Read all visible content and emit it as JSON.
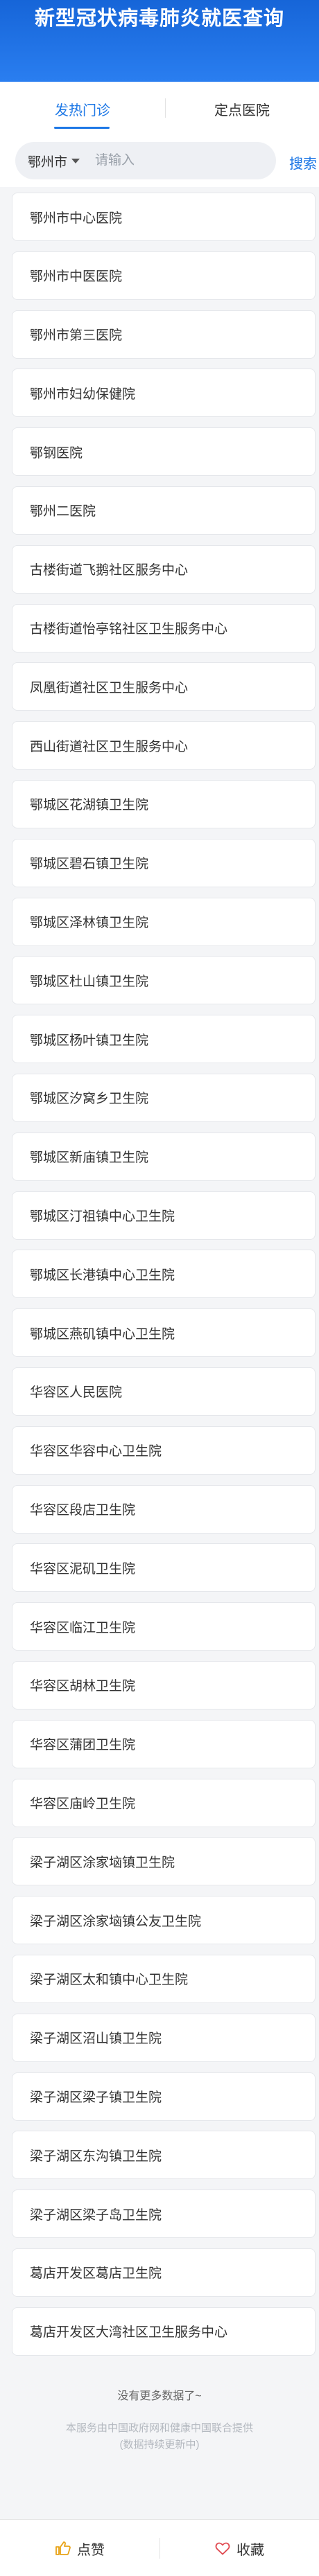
{
  "header": {
    "title": "新型冠状病毒肺炎就医查询"
  },
  "tabs": [
    {
      "label": "发热门诊",
      "active": true
    },
    {
      "label": "定点医院",
      "active": false
    }
  ],
  "search": {
    "city": "鄂州市",
    "placeholder": "请输入",
    "button_label": "搜索"
  },
  "hospitals": [
    "鄂州市中心医院",
    "鄂州市中医医院",
    "鄂州市第三医院",
    "鄂州市妇幼保健院",
    "鄂钢医院",
    "鄂州二医院",
    "古楼街道飞鹅社区服务中心",
    "古楼街道怡亭铭社区卫生服务中心",
    "凤凰街道社区卫生服务中心",
    "西山街道社区卫生服务中心",
    "鄂城区花湖镇卫生院",
    "鄂城区碧石镇卫生院",
    "鄂城区泽林镇卫生院",
    "鄂城区杜山镇卫生院",
    "鄂城区杨叶镇卫生院",
    "鄂城区汐窝乡卫生院",
    "鄂城区新庙镇卫生院",
    "鄂城区汀祖镇中心卫生院",
    "鄂城区长港镇中心卫生院",
    "鄂城区燕矶镇中心卫生院",
    "华容区人民医院",
    "华容区华容中心卫生院",
    "华容区段店卫生院",
    "华容区泥矶卫生院",
    "华容区临江卫生院",
    "华容区胡林卫生院",
    "华容区蒲团卫生院",
    "华容区庙岭卫生院",
    "梁子湖区涂家垴镇卫生院",
    "梁子湖区涂家垴镇公友卫生院",
    "梁子湖区太和镇中心卫生院",
    "梁子湖区沼山镇卫生院",
    "梁子湖区梁子镇卫生院",
    "梁子湖区东沟镇卫生院",
    "梁子湖区梁子岛卫生院",
    "葛店开发区葛店卫生院",
    "葛店开发区大湾社区卫生服务中心"
  ],
  "footer": {
    "no_more": "没有更多数据了~",
    "source_line1": "本服务由中国政府网和健康中国联合提供",
    "source_line2": "(数据持续更新中)"
  },
  "bottom_bar": {
    "like_label": "点赞",
    "favorite_label": "收藏"
  },
  "colors": {
    "primary": "#1e78e6",
    "header_bg": "#1665d8",
    "like_icon": "#e8a317",
    "favorite_icon": "#e0484f"
  }
}
